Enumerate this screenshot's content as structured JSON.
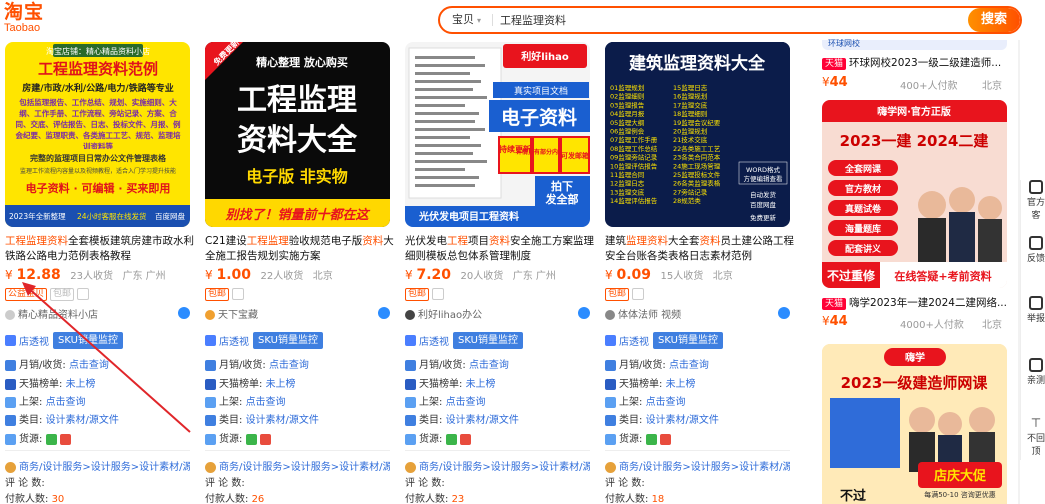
{
  "header": {
    "logo_cn": "淘宝",
    "logo_en": "Taobao",
    "search_scope": "宝贝",
    "search_value": "工程监理资料",
    "search_button": "搜索"
  },
  "products": [
    {
      "image": {
        "banner": "淘宝店铺：精心精品资料小店",
        "headline": "工程监理资料范例",
        "subline": "房建/市政/水利/公路/电力/铁路等专业",
        "body": "包括监理报告、工作总结、规划、实施细则、大纲、工作手册、工作流程、旁站记录、方案、合同、交底、评估报告、日志、投标文件、月报、例会纪要、监理职责、各类施工工艺、规范、监理培训资料等",
        "note": "完整的监理项目日常办公文件管理表格",
        "note2": "监理工作流程内容量以及视频教程，适合入门学习提升技能",
        "bottom": "电子资料 · 可编辑 · 买来即用",
        "footer_a": "2023年全新整理",
        "footer_b": "24小时客服在线发货",
        "footer_c": "百度网盘"
      },
      "title_hl": "工程监理资料",
      "title_rest": "全套模板建筑房建市政水利铁路公路电力范例表格教程",
      "price_symbol": "¥",
      "price": "12.88",
      "sales": "23人收货",
      "location": "广东 广州",
      "tags": [
        "公益宝贝",
        "包邮"
      ],
      "shop": "精心精品资料小店",
      "tool_label": "店透视",
      "sku_label": "SKU销量监控",
      "rows": {
        "monthly_label": "月销/收货:",
        "monthly_value": "点击查询",
        "tmall_label": "天猫榜单:",
        "tmall_value": "未上榜",
        "shelf_label": "上架:",
        "shelf_value": "点击查询",
        "category_label": "类目:",
        "category_value": "设计素材/源文件",
        "source_label": "货源:"
      },
      "category_path": "商务/设计服务>设计服务>设计素材/源...",
      "review_label": "评 论 数:",
      "review_count": "",
      "pay_label": "付款人数:",
      "pay_count": "30"
    },
    {
      "image": {
        "corner": "免费更新",
        "top": "精心整理 放心购买",
        "line1": "工程监理",
        "line2": "资料大全",
        "line3": "电子版 非实物",
        "bottom": "别找了！销量前十都在这"
      },
      "title_pre": "C21建设",
      "title_hl": "工程监理",
      "title_mid": "验收规范电子版",
      "title_hl2": "资料",
      "title_rest": "大全施工报告规划实施方案",
      "price_symbol": "¥",
      "price": "1.00",
      "sales": "22人收货",
      "location": "北京",
      "tags": [
        "包邮"
      ],
      "shop": "天下宝藏",
      "tool_label": "店透视",
      "sku_label": "SKU销量监控",
      "rows": {
        "monthly_label": "月销/收货:",
        "monthly_value": "点击查询",
        "tmall_label": "天猫榜单:",
        "tmall_value": "未上榜",
        "shelf_label": "上架:",
        "shelf_value": "点击查询",
        "category_label": "类目:",
        "category_value": "设计素材/源文件",
        "source_label": "货源:"
      },
      "category_path": "商务/设计服务>设计服务>设计素材/源...",
      "review_label": "评 论 数:",
      "review_count": "",
      "pay_label": "付款人数:",
      "pay_count": "26"
    },
    {
      "image": {
        "brand": "利好lihao",
        "tag1": "真实项目文档",
        "headline": "电子资料",
        "badge1": "持续更新",
        "badge2": "详情页有部分内容预览",
        "badge3": "可发邮箱",
        "ship1": "拍下",
        "ship2": "发全部",
        "bottom": "光伏发电项目工程资料"
      },
      "title_pre": "光伏发电",
      "title_hl": "工程",
      "title_mid": "项目",
      "title_hl2": "资料",
      "title_rest": "安全施工方案监理细则模板总包体系管理制度",
      "price_symbol": "¥",
      "price": "7.20",
      "sales": "20人收货",
      "location": "广东 广州",
      "tags": [
        "包邮"
      ],
      "shop": "利好lihao办公",
      "tool_label": "店透视",
      "sku_label": "SKU销量监控",
      "rows": {
        "monthly_label": "月销/收货:",
        "monthly_value": "点击查询",
        "tmall_label": "天猫榜单:",
        "tmall_value": "未上榜",
        "shelf_label": "上架:",
        "shelf_value": "点击查询",
        "category_label": "类目:",
        "category_value": "设计素材/源文件",
        "source_label": "货源:"
      },
      "category_path": "商务/设计服务>设计服务>设计素材/源...",
      "review_label": "评 论 数:",
      "review_count": "",
      "pay_label": "付款人数:",
      "pay_count": "23"
    },
    {
      "image": {
        "headline": "建筑监理资料大全",
        "list_left": [
          "01监理规划",
          "02监理细则",
          "03监理报告",
          "04监理月报",
          "05监理大纲",
          "06监理例会",
          "07监理工作手册",
          "08监理工作总结",
          "09监理旁站记录",
          "10监理评估报告",
          "11监理合同",
          "12监理日志",
          "13监理交底",
          "14监理评估报告"
        ],
        "list_right": [
          "15监理日志",
          "16监理规划",
          "17监理交底",
          "18监理细则",
          "19监理会议纪要",
          "20监理规划",
          "21技术交底",
          "22各类施工工艺",
          "23各类合同范本",
          "24施工现场管理",
          "25监理投标文件",
          "26各类监理表格",
          "27旁站记录",
          "28规范类"
        ],
        "word1": "WORD格式",
        "word2": "方便编辑查看",
        "ship1": "自动发货",
        "ship2": "百度网盘",
        "ship3": "免费更新"
      },
      "title_pre": "建筑",
      "title_hl": "监理资料",
      "title_mid": "大全套",
      "title_hl2": "资料",
      "title_rest": "员土建公路工程安全台账各类表格日志素材范例",
      "price_symbol": "¥",
      "price": "0.09",
      "sales": "15人收货",
      "location": "北京",
      "tags": [
        "包邮"
      ],
      "shop": "体体法师 视频",
      "tool_label": "店透视",
      "sku_label": "SKU销量监控",
      "rows": {
        "monthly_label": "月销/收货:",
        "monthly_value": "点击查询",
        "tmall_label": "天猫榜单:",
        "tmall_value": "未上榜",
        "shelf_label": "上架:",
        "shelf_value": "点击查询",
        "category_label": "类目:",
        "category_value": "设计素材/源文件",
        "source_label": "货源:"
      },
      "category_path": "商务/设计服务>设计服务>设计素材/源...",
      "review_label": "评 论 数:",
      "review_count": "",
      "pay_label": "付款人数:",
      "pay_count": "18"
    }
  ],
  "right_column": {
    "item1": {
      "tmall_badge": "天猫",
      "title": "环球网校2023一级二级建造师...",
      "price_symbol": "¥",
      "price": "44",
      "sales": "400+人付款",
      "location": "北京",
      "top_partial": "环球网校"
    },
    "ad1": {
      "brand": "嗨学网·官方正版",
      "headline": "2023一建 2024二建",
      "bullets": [
        "全套网课",
        "官方教材",
        "真题试卷",
        "海量题库",
        "配套讲义"
      ],
      "bottom_red": "不过重修",
      "bottom_blue": "在线答疑+考前资料"
    },
    "item2": {
      "tmall_badge": "天猫",
      "title": "嗨学2023年一建2024二建网络...",
      "price_symbol": "¥",
      "price": "44",
      "sales": "4000+人付款",
      "location": "北京"
    },
    "ad2": {
      "brand": "嗨学",
      "headline": "2023一级建造师网课",
      "badge1": "店庆大促",
      "badge2": "每满50-10 咨询更优惠",
      "bottom": "不过"
    }
  },
  "sidebar": {
    "items": [
      "官方客",
      "反馈",
      "举报",
      "亲测",
      "不回顶"
    ]
  },
  "colors": {
    "brand": "#ff5000",
    "link": "#2f6cd9",
    "sku": "#3f7fe0",
    "annotation": "#e0262a"
  }
}
